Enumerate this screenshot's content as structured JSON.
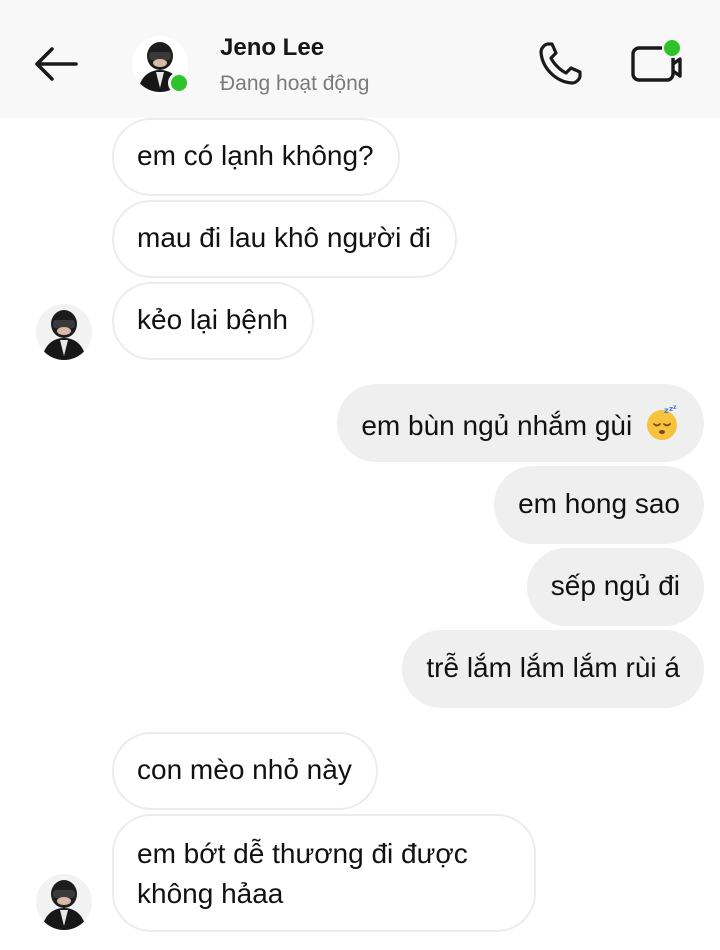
{
  "header": {
    "contact_name": "Jeno Lee",
    "status": "Đang hoạt động",
    "back_icon": "arrow-left-icon",
    "call_icon": "phone-icon",
    "video_icon": "video-camera-icon",
    "online_color": "#2fc22b"
  },
  "messages": [
    {
      "side": "in",
      "text": "em có lạnh không?"
    },
    {
      "side": "in",
      "text": "mau đi lau khô người đi"
    },
    {
      "side": "in",
      "text": "kẻo lại bệnh"
    },
    {
      "side": "out",
      "text": "em bùn ngủ nhắm gùi",
      "emoji": "sleeping-face-icon"
    },
    {
      "side": "out",
      "text": "em hong sao"
    },
    {
      "side": "out",
      "text": "sếp ngủ đi"
    },
    {
      "side": "out",
      "text": "trễ lắm lắm lắm rùi á"
    },
    {
      "side": "in",
      "text": "con mèo nhỏ này"
    },
    {
      "side": "in",
      "text": "em bớt dễ thương đi được không hảaa"
    }
  ],
  "colors": {
    "incoming_bubble": "#ffffff",
    "outgoing_bubble": "#efefef",
    "header_bg": "#f8f8f8"
  }
}
